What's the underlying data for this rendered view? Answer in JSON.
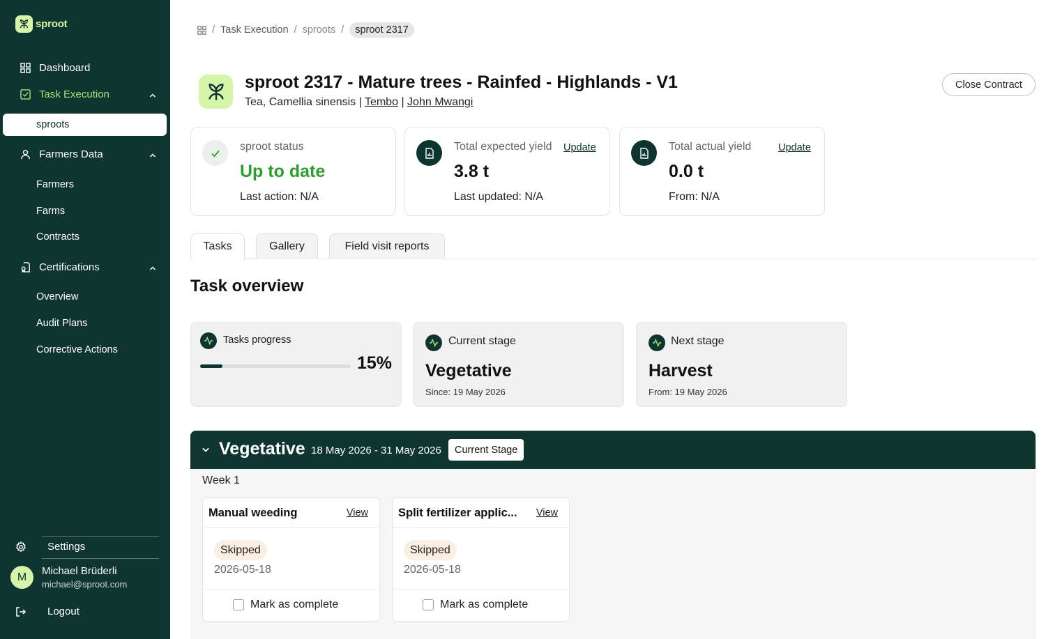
{
  "brand": {
    "name": "sproot",
    "accent": "#0e3530",
    "highlight": "#d6f5a8",
    "active_green": "#a8e37a"
  },
  "sidebar": {
    "dashboard": "Dashboard",
    "task_execution": "Task Execution",
    "task_execution_items": [
      "sproots"
    ],
    "farmers_data": "Farmers Data",
    "farmers_data_items": [
      "Farmers",
      "Farms",
      "Contracts"
    ],
    "certifications": "Certifications",
    "certifications_items": [
      "Overview",
      "Audit Plans",
      "Corrective Actions"
    ],
    "settings": "Settings",
    "logout": "Logout",
    "user": {
      "initial": "M",
      "name": "Michael Brüderli",
      "email": "michael@sproot.com"
    }
  },
  "breadcrumb": {
    "items": [
      "Task Execution",
      "sproots"
    ],
    "current": "sproot 2317",
    "separator": "/"
  },
  "header": {
    "title": "sproot 2317 - Mature trees - Rainfed - Highlands - V1",
    "crop": "Tea, Camellia sinensis",
    "sep": "|",
    "location": "Tembo",
    "farmer": "John Mwangi",
    "close_button": "Close Contract"
  },
  "stats": {
    "status": {
      "label": "sproot status",
      "value": "Up to date",
      "sub": "Last action: N/A"
    },
    "expected": {
      "label": "Total expected yield",
      "update": "Update",
      "value": "3.8 t",
      "sub": "Last updated: N/A"
    },
    "actual": {
      "label": "Total actual yield",
      "update": "Update",
      "value": "0.0 t",
      "sub": "From: N/A"
    }
  },
  "tabs": [
    "Tasks",
    "Gallery",
    "Field visit reports"
  ],
  "overview": {
    "title": "Task overview",
    "progress": {
      "label": "Tasks progress",
      "value": "15%",
      "fraction": 0.15
    },
    "current": {
      "label": "Current stage",
      "value": "Vegetative",
      "sub": "Since: 19 May 2026"
    },
    "next": {
      "label": "Next stage",
      "value": "Harvest",
      "sub": "From: 19 May 2026"
    }
  },
  "stage": {
    "name": "Vegetative",
    "dates": "18 May 2026 - 31 May 2026",
    "badge": "Current Stage",
    "week": "Week 1",
    "tasks": [
      {
        "title": "Manual weeding",
        "view": "View",
        "status": "Skipped",
        "date": "2026-05-18",
        "mark": "Mark as complete"
      },
      {
        "title": "Split fertilizer applic...",
        "view": "View",
        "status": "Skipped",
        "date": "2026-05-18",
        "mark": "Mark as complete"
      }
    ]
  }
}
